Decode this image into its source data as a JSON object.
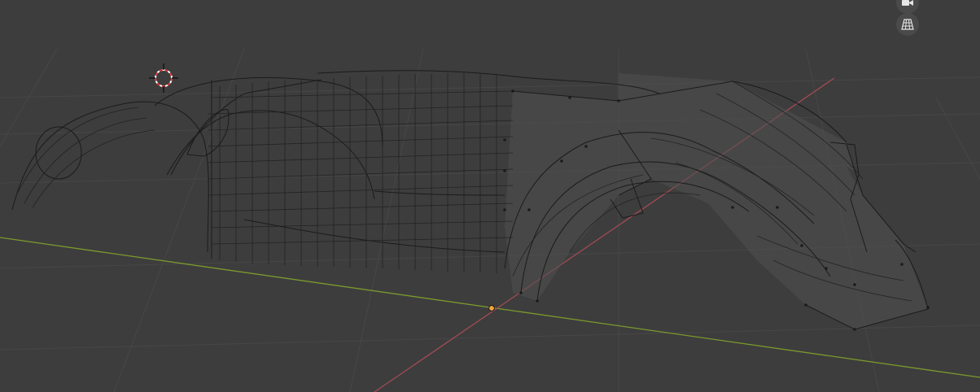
{
  "viewport": {
    "background_color": "#3d3d3d",
    "grid_color": "#474747",
    "x_axis_color": "#a24b55",
    "y_axis_color": "#7a9a2d",
    "mesh_wire_color": "#1b1b1b",
    "mesh_fill_color": "#505050",
    "origin_color": "#f3a53a",
    "cursor_color": "#e23b3b"
  },
  "gizmo": {
    "camera_button_icon": "video-camera-icon",
    "ortho_button_icon": "grid-perspective-icon"
  }
}
